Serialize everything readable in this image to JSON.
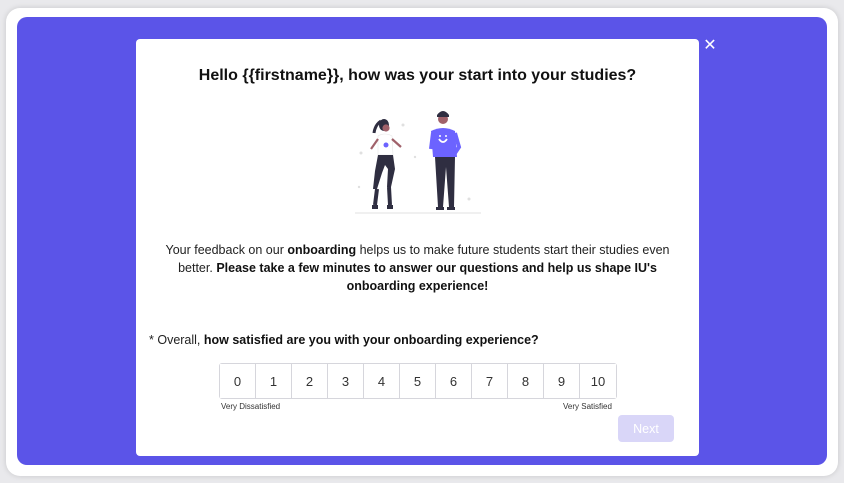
{
  "modal": {
    "close_symbol": "✕",
    "title": "Hello {{firstname}}, how was your start into your studies?",
    "description": {
      "part1": "Your feedback on our ",
      "bold1": "onboarding",
      "part2": " helps us to make future students start their studies even better. ",
      "bold2": "Please take a few minutes to answer our questions and help us shape IU's onboarding experience!"
    },
    "question": {
      "required_marker": "* ",
      "prefix": "Overall, ",
      "bold": "how satisfied are you with your onboarding experience?"
    },
    "scale": {
      "options": [
        "0",
        "1",
        "2",
        "3",
        "4",
        "5",
        "6",
        "7",
        "8",
        "9",
        "10"
      ],
      "label_low": "Very Dissatisfied",
      "label_high": "Very Satisfied"
    },
    "next_label": "Next"
  },
  "colors": {
    "overlay": "#5b54e8",
    "accent": "#6c63ff",
    "next_disabled": "#d9d6f8"
  },
  "icons": {
    "close": "close-icon",
    "illustration": "two-people-illustration"
  }
}
